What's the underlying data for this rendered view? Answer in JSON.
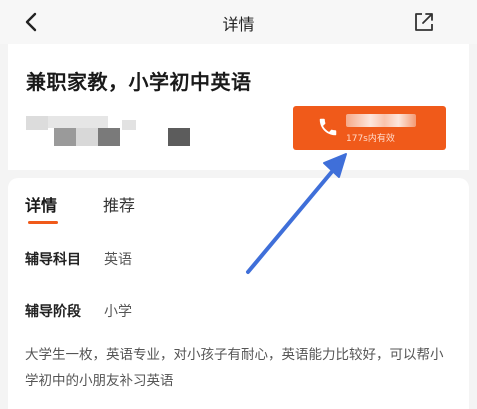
{
  "nav": {
    "title": "详情",
    "back_icon": "chevron-left-icon",
    "share_icon": "share-external-icon"
  },
  "header": {
    "job_title": "兼职家教，小学初中英语",
    "call_button": {
      "validity": "177s内有效",
      "icon": "phone-icon",
      "color": "#f05a1a"
    }
  },
  "tabs": [
    {
      "label": "详情",
      "active": true
    },
    {
      "label": "推荐",
      "active": false
    }
  ],
  "details": {
    "subject_label": "辅导科目",
    "subject_value": "英语",
    "stage_label": "辅导阶段",
    "stage_value": "小学",
    "description": "大学生一枚，英语专业，对小孩子有耐心，英语能力比较好，可以帮小学初中的小朋友补习英语"
  },
  "colors": {
    "accent": "#f05a1a",
    "annotation_arrow": "#3f6fd9"
  }
}
